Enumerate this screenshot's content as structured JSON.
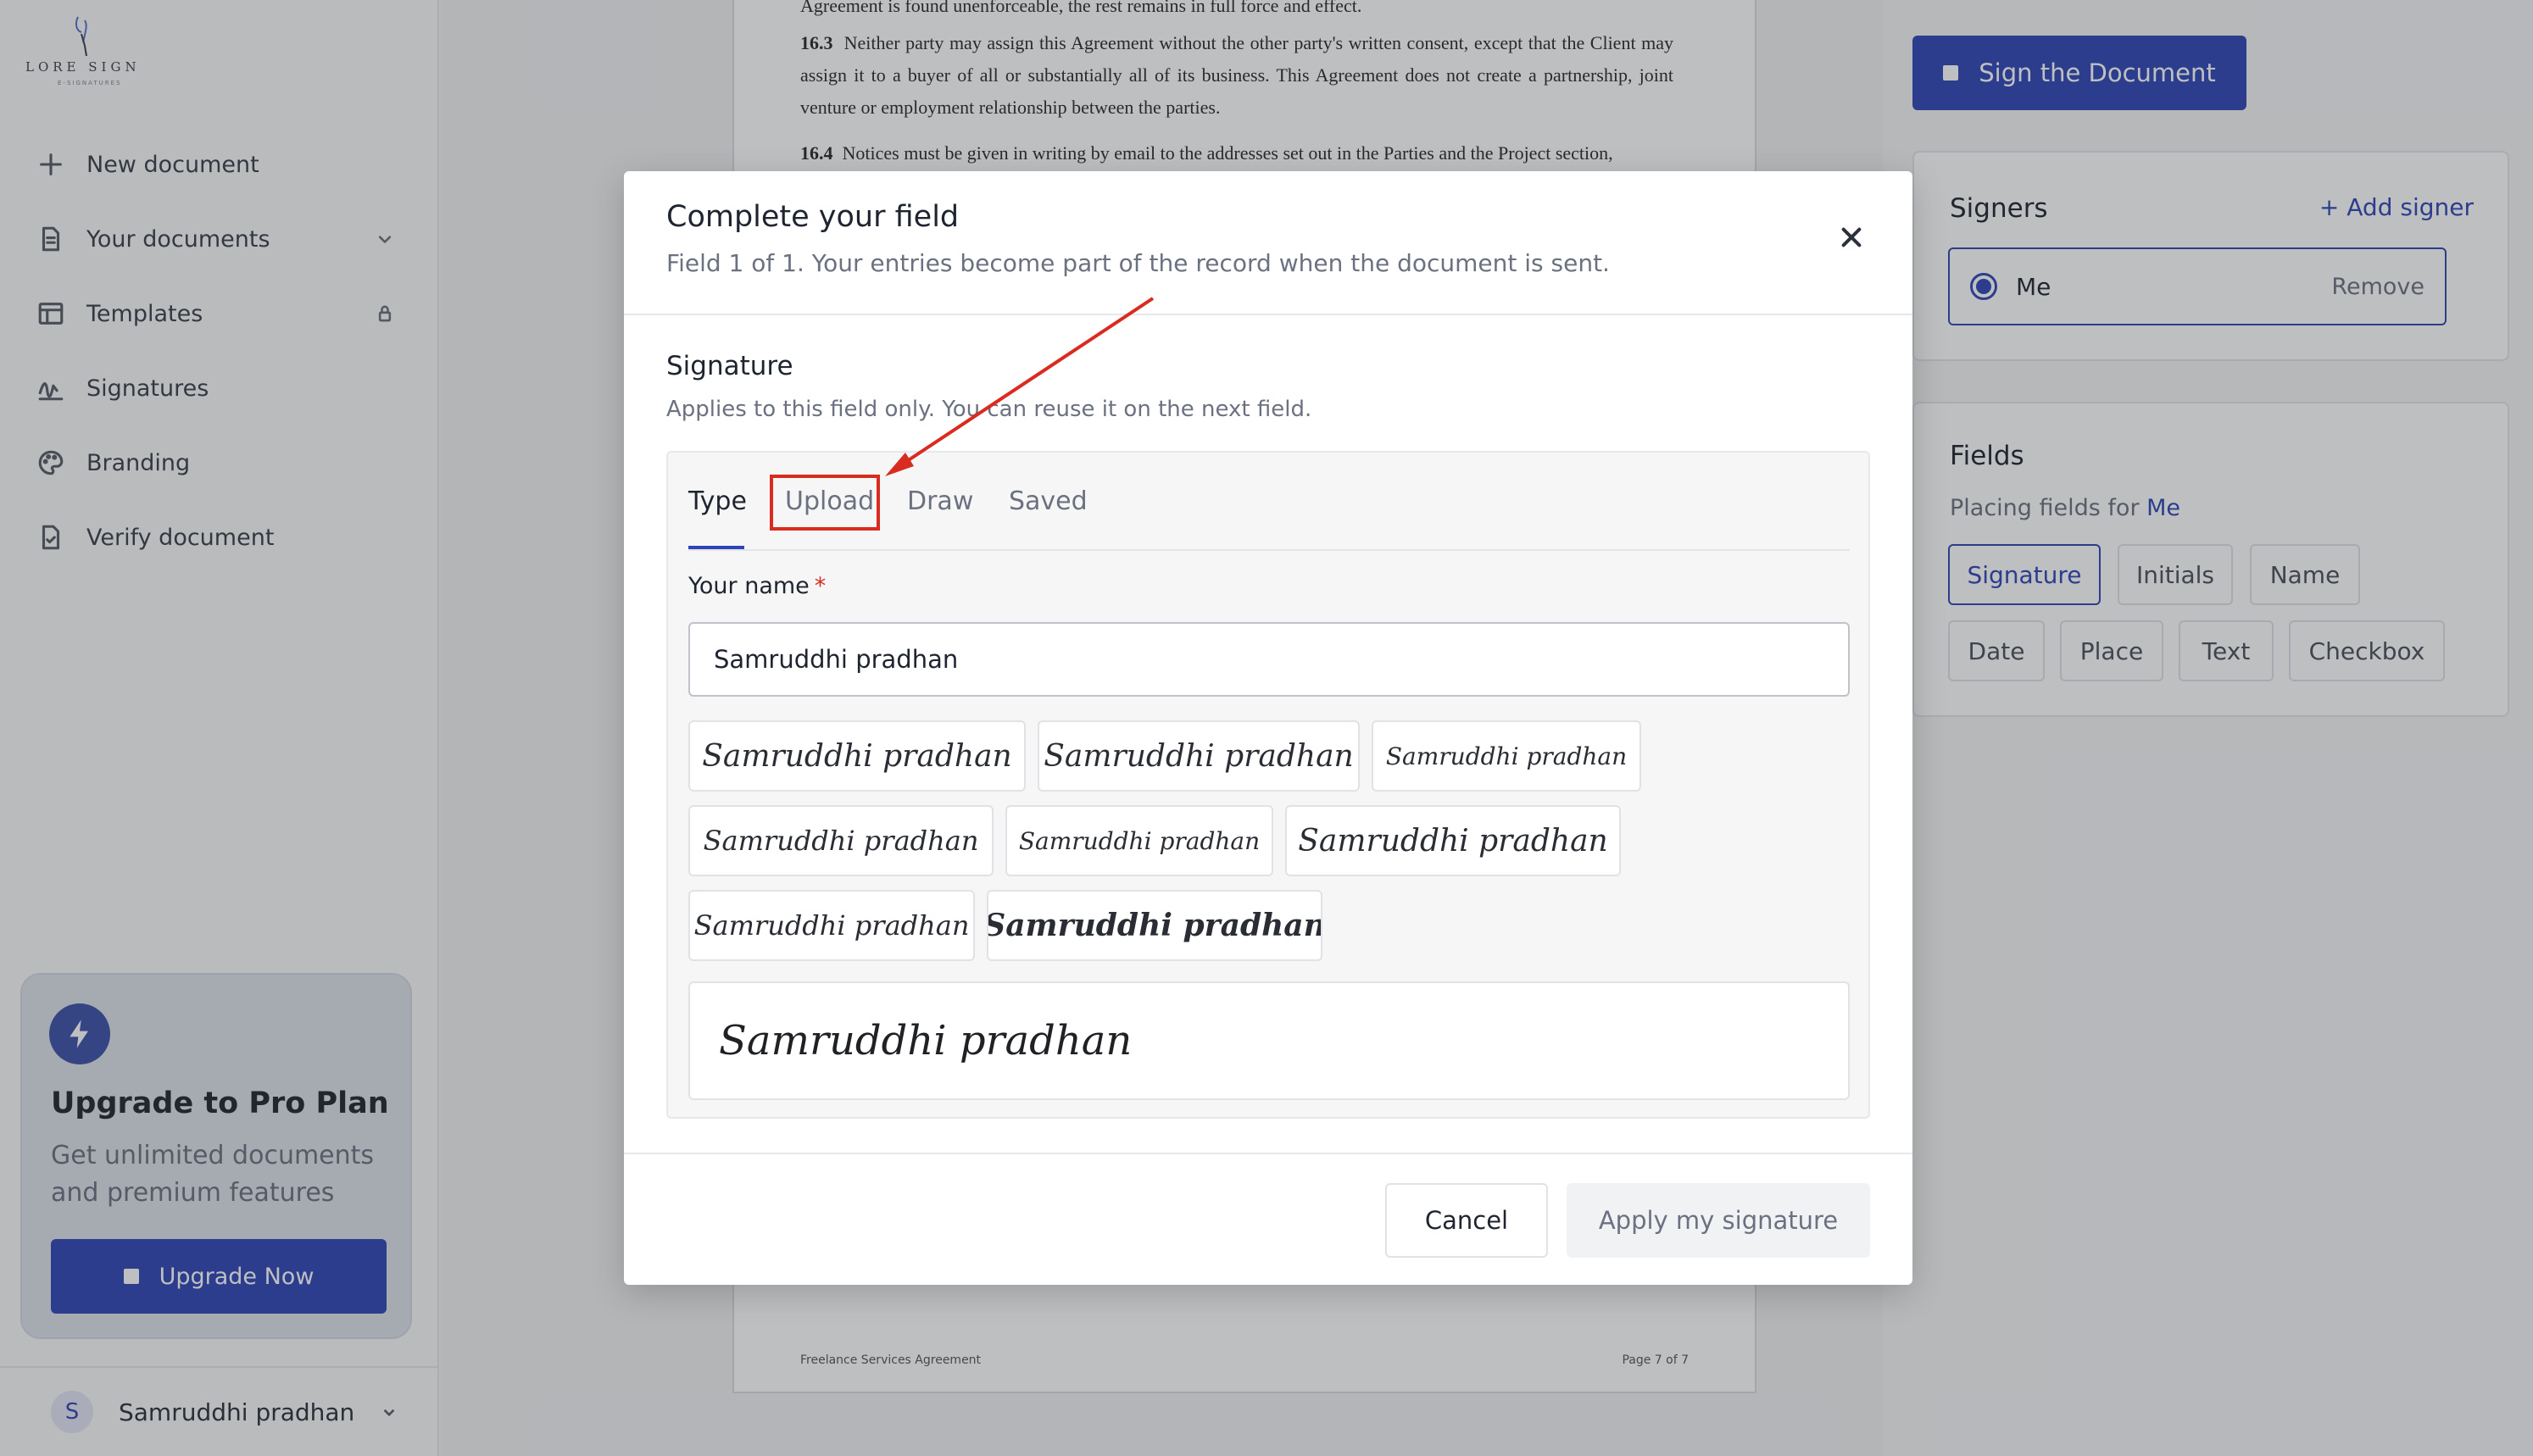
{
  "app": {
    "logo_text": "LORE  SIGN",
    "logo_sub": "E-SIGNATURES"
  },
  "sidebar": {
    "items": [
      {
        "label": "New document",
        "icon": "plus-icon"
      },
      {
        "label": "Your documents",
        "icon": "document-icon"
      },
      {
        "label": "Templates",
        "icon": "template-icon"
      },
      {
        "label": "Signatures",
        "icon": "signature-icon"
      },
      {
        "label": "Branding",
        "icon": "palette-icon"
      },
      {
        "label": "Verify document",
        "icon": "verify-icon"
      }
    ],
    "upgrade": {
      "title": "Upgrade to Pro Plan",
      "desc": "Get unlimited documents and premium features",
      "button": "Upgrade Now"
    },
    "user": {
      "initial": "S",
      "name": "Samruddhi pradhan"
    }
  },
  "document": {
    "para_top": "Agreement is found unenforceable, the rest remains in full force and effect.",
    "para_163_num": "16.3",
    "para_163": "Neither party may assign this Agreement without the other party's written consent, except that the Client may assign it to a buyer of all or substantially all of its business. This Agreement does not create a partnership, joint venture or employment relationship between the parties.",
    "para_164_num": "16.4",
    "para_164": "Notices must be given in writing by email to the addresses set out in the Parties and the Project section,",
    "footer_left": "Freelance Services Agreement",
    "footer_right": "Page 7 of 7"
  },
  "right_panel": {
    "sign_button": "Sign the Document",
    "signers": {
      "title": "Signers",
      "add": "Add signer",
      "signer_name": "Me",
      "remove": "Remove"
    },
    "fields": {
      "title": "Fields",
      "placing_prefix": "Placing fields for",
      "placing_who": "Me",
      "chips": [
        "Signature",
        "Initials",
        "Name",
        "Date",
        "Place",
        "Text",
        "Checkbox"
      ]
    }
  },
  "modal": {
    "title": "Complete your field",
    "subtitle": "Field 1 of 1. Your entries become part of the record when the document is sent.",
    "section_title": "Signature",
    "section_sub": "Applies to this field only. You can reuse it on the next field.",
    "tabs": [
      "Type",
      "Upload",
      "Draw",
      "Saved"
    ],
    "name_label": "Your name",
    "required_mark": "*",
    "name_value": "Samruddhi pradhan",
    "style_options": [
      "Samruddhi pradhan",
      "Samruddhi pradhan",
      "Samruddhi pradhan",
      "Samruddhi pradhan",
      "Samruddhi pradhan",
      "Samruddhi pradhan",
      "Samruddhi pradhan",
      "Samruddhi pradhan"
    ],
    "preview": "Samruddhi pradhan",
    "cancel": "Cancel",
    "apply": "Apply my signature"
  },
  "colors": {
    "accent": "#2f45b7",
    "annotation": "#d92b1f"
  }
}
